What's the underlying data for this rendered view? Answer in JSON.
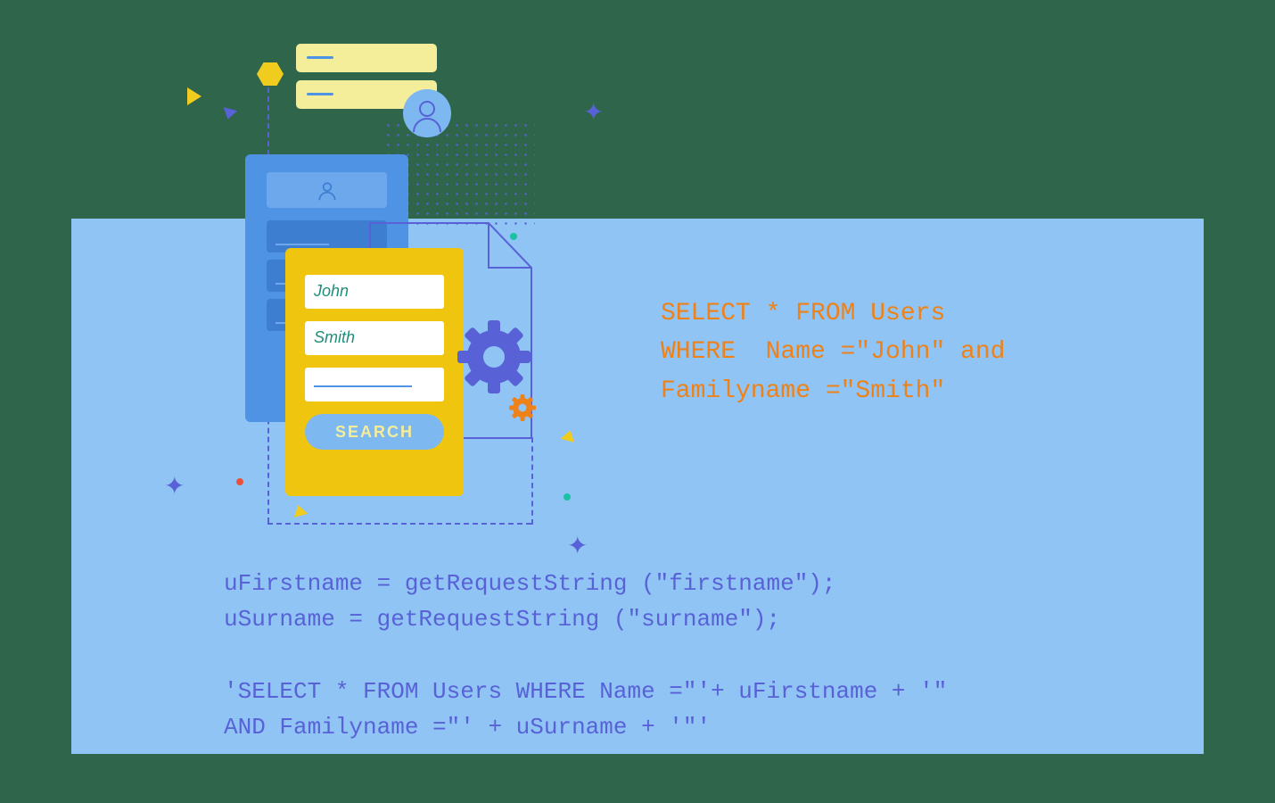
{
  "form": {
    "firstname_value": "John",
    "surname_value": "Smith",
    "search_label": "SEARCH"
  },
  "sql": {
    "line1": "SELECT * FROM Users",
    "line2": "WHERE  Name =\"John\" and",
    "line3": "Familyname =\"Smith\""
  },
  "code": {
    "line1": "uFirstname = getRequestString (\"firstname\");",
    "line2": "uSurname = getRequestString (\"surname\");",
    "line3": "",
    "line4": "'SELECT * FROM Users WHERE Name =\"'+ uFirstname + '\"",
    "line5": "AND Familyname =\"' + uSurname + '\"'"
  },
  "icons": {
    "user": "user-icon",
    "gear": "gear-icon",
    "document": "document-icon",
    "plus": "plus-icon"
  },
  "colors": {
    "panel": "#90c4f5",
    "accent_blue": "#4e93e4",
    "accent_yellow": "#f0c510",
    "accent_purple": "#5862d6",
    "accent_orange": "#ee8218",
    "accent_teal": "#1f8e7a"
  }
}
